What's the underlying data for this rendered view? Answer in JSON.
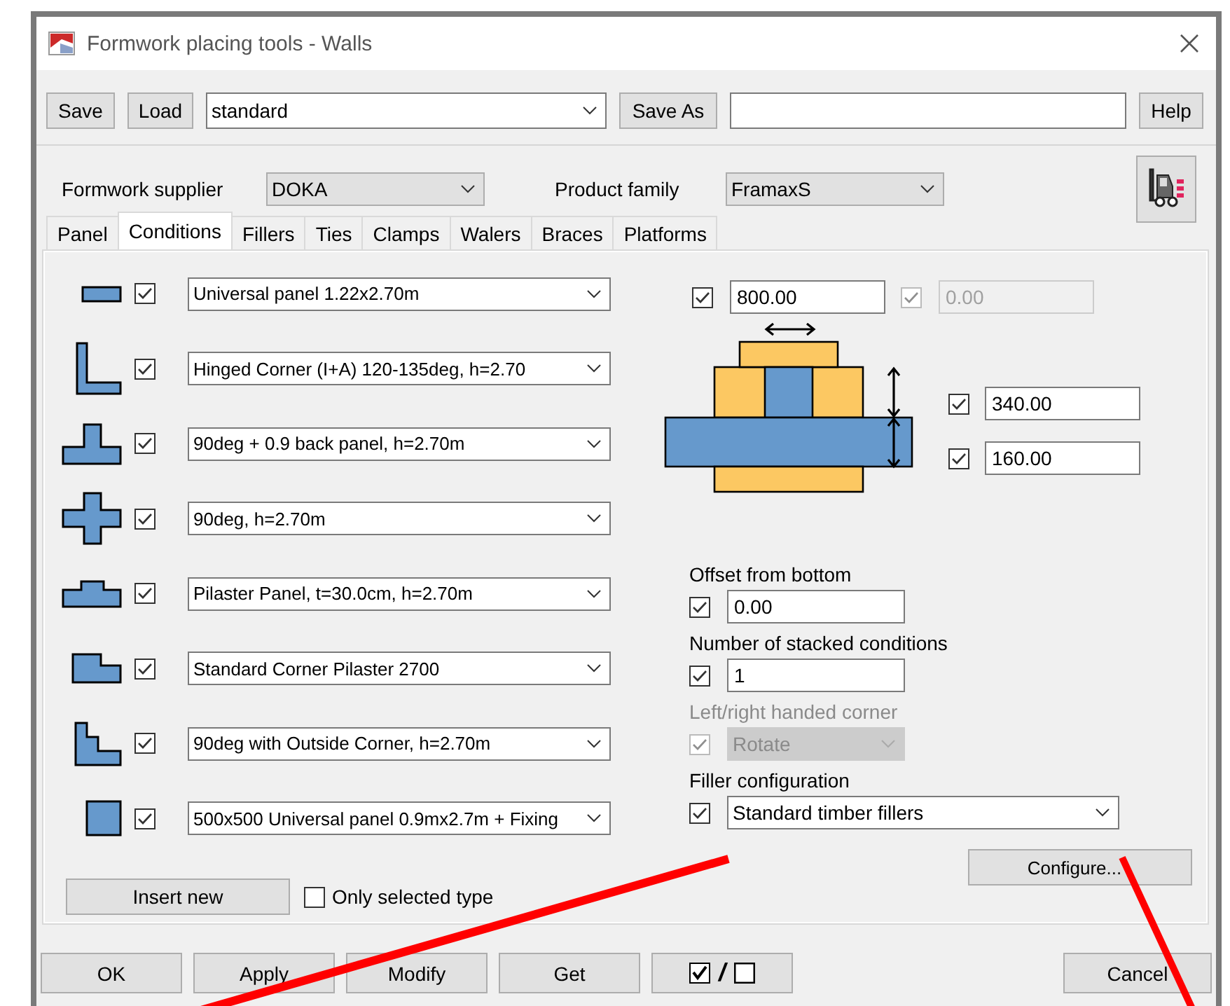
{
  "window": {
    "title": "Formwork placing tools - Walls"
  },
  "toolbar": {
    "save": "Save",
    "load": "Load",
    "preset": "standard",
    "save_as": "Save As",
    "help": "Help"
  },
  "supplier": {
    "label": "Formwork supplier",
    "value": "DOKA"
  },
  "product_family": {
    "label": "Product family",
    "value": "FramaxS"
  },
  "tabs": [
    {
      "label": "Panel",
      "selected": false
    },
    {
      "label": "Conditions",
      "selected": true
    },
    {
      "label": "Fillers",
      "selected": false
    },
    {
      "label": "Ties",
      "selected": false
    },
    {
      "label": "Clamps",
      "selected": false
    },
    {
      "label": "Walers",
      "selected": false
    },
    {
      "label": "Braces",
      "selected": false
    },
    {
      "label": "Platforms",
      "selected": false
    }
  ],
  "conditions": [
    {
      "kind": "straight",
      "checked": true,
      "value": "Universal panel 1.22x2.70m"
    },
    {
      "kind": "corner",
      "checked": true,
      "value": "Hinged Corner (I+A) 120-135deg, h=2.70"
    },
    {
      "kind": "t-junction",
      "checked": true,
      "value": "90deg + 0.9 back panel, h=2.70m"
    },
    {
      "kind": "cross",
      "checked": true,
      "value": "90deg, h=2.70m"
    },
    {
      "kind": "pilaster",
      "checked": true,
      "value": "Pilaster Panel, t=30.0cm, h=2.70m"
    },
    {
      "kind": "corner-pilaster",
      "checked": true,
      "value": "Standard Corner Pilaster 2700"
    },
    {
      "kind": "outside-corner",
      "checked": true,
      "value": "90deg with Outside Corner, h=2.70m"
    },
    {
      "kind": "column",
      "checked": true,
      "value": "500x500 Universal panel 0.9mx2.7m + Fixing"
    }
  ],
  "insert_button": "Insert new",
  "only_selected": {
    "label": "Only selected type",
    "checked": false
  },
  "dimensions": {
    "width": {
      "checked": true,
      "disabled": false,
      "value": "800.00"
    },
    "offset": {
      "checked": true,
      "disabled": true,
      "value": "0.00"
    },
    "depth": {
      "checked": true,
      "disabled": false,
      "value": "340.00"
    },
    "thickness": {
      "checked": true,
      "disabled": false,
      "value": "160.00"
    }
  },
  "options": [
    {
      "kind": "field",
      "label": "Offset from bottom",
      "checked": true,
      "disabled": false,
      "value": "0.00"
    },
    {
      "kind": "field",
      "label": "Number of stacked conditions",
      "checked": true,
      "disabled": false,
      "value": "1"
    },
    {
      "kind": "dropdown",
      "label": "Left/right handed corner",
      "checked": true,
      "disabled": true,
      "value": "Rotate"
    },
    {
      "kind": "wide-dropdown",
      "label": "Filler configuration",
      "checked": true,
      "disabled": false,
      "value": "Standard timber fillers"
    }
  ],
  "configure_button": "Configure...",
  "footer_buttons": [
    {
      "kind": "text",
      "label": "OK"
    },
    {
      "kind": "text",
      "label": "Apply"
    },
    {
      "kind": "text",
      "label": "Modify"
    },
    {
      "kind": "text",
      "label": "Get"
    },
    {
      "kind": "check-toggle",
      "label": "/"
    }
  ],
  "cancel_button": "Cancel"
}
